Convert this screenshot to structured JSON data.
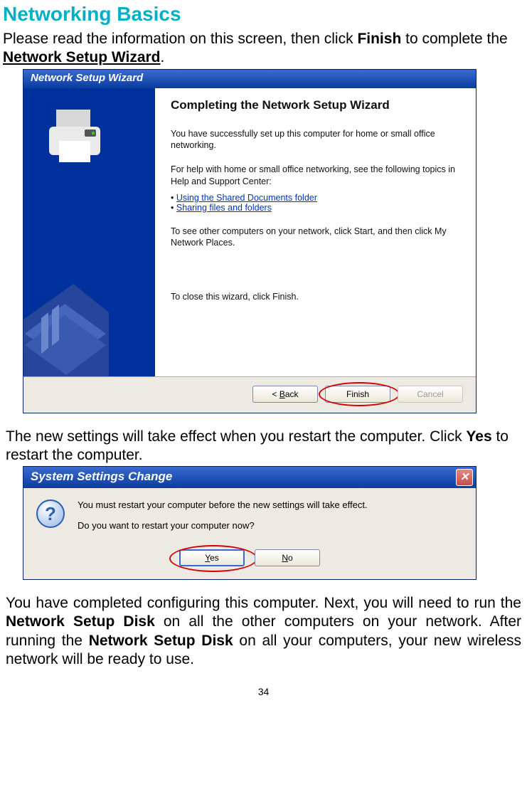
{
  "page_title": "Networking Basics",
  "intro": {
    "pre": "Please read the information on this screen, then click ",
    "bold1": "Finish",
    "mid": " to complete the ",
    "bold2_underline": "Network Setup Wizard",
    "post": "."
  },
  "wizard_dialog": {
    "titlebar": "Network Setup Wizard",
    "heading": "Completing the Network Setup Wizard",
    "p1": "You have successfully set up this computer for home or small office networking.",
    "p2": "For help with home or small office networking, see the following topics in Help and Support Center:",
    "links": [
      "Using the Shared Documents folder",
      "Sharing files and folders"
    ],
    "p3": "To see other computers on your network, click Start, and then click My Network Places.",
    "closer": "To close this wizard, click Finish.",
    "buttons": {
      "back": "< Back",
      "finish": "Finish",
      "cancel": "Cancel"
    }
  },
  "middle": {
    "line1": "The new settings will take effect when you restart the computer.  Click ",
    "bold": "Yes",
    "line2": " to restart the computer."
  },
  "restart_dialog": {
    "titlebar": "System Settings Change",
    "msg1": "You must restart your computer before the new settings will take effect.",
    "msg2": "Do you want to restart your computer now?",
    "yes": "Yes",
    "no": "No"
  },
  "post": {
    "t1": "You have completed configuring this computer.  Next, you will need to run the ",
    "b1": "Network Setup Disk",
    "t2": " on all the other computers on your network.  After running the ",
    "b2": "Network Setup Disk",
    "t3": " on all your computers, your new wireless network will be ready to use."
  },
  "page_number": "34"
}
